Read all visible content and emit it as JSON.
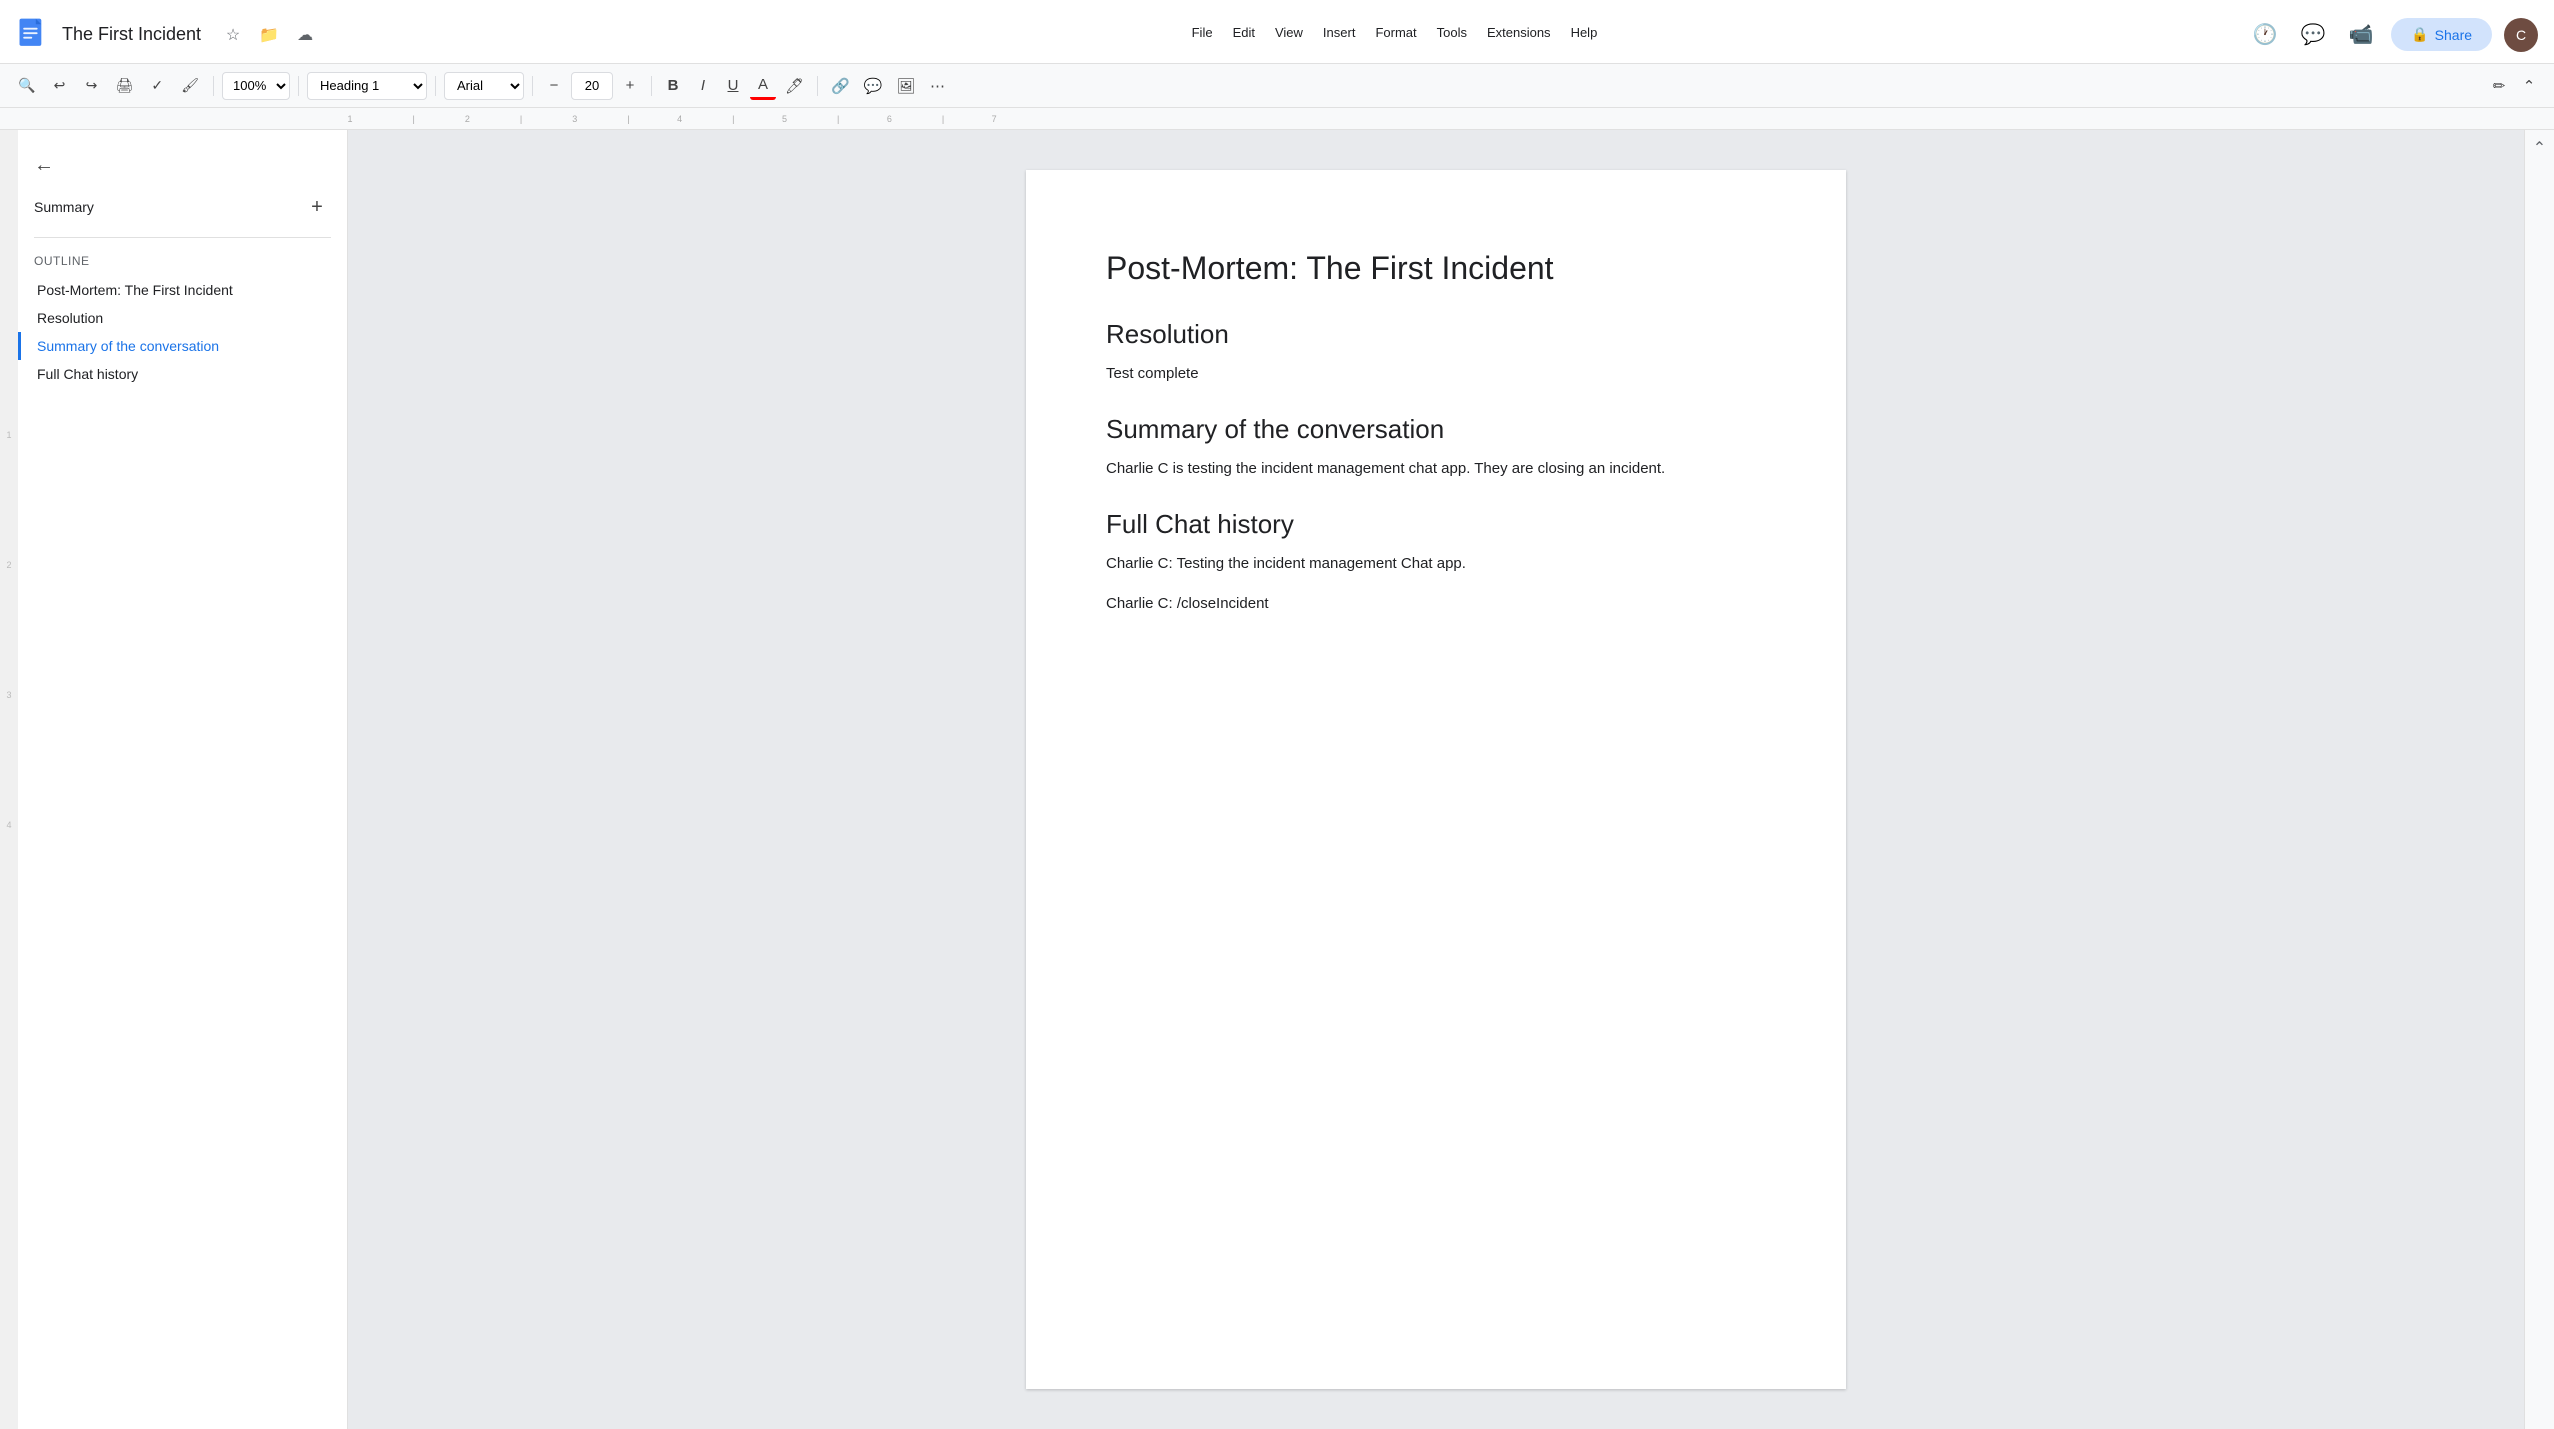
{
  "app": {
    "doc_icon_label": "G",
    "doc_title": "The First Incident",
    "menu_items": [
      "File",
      "Edit",
      "View",
      "Insert",
      "Format",
      "Tools",
      "Extensions",
      "Help"
    ],
    "share_label": "Share",
    "zoom": "100%",
    "style": "Heading 1",
    "font": "Arial",
    "font_size": "20",
    "toolbar": {
      "bold": "B",
      "italic": "I",
      "underline": "U",
      "minus": "−",
      "plus": "+"
    }
  },
  "sidebar": {
    "summary_label": "Summary",
    "outline_label": "Outline",
    "outline_items": [
      {
        "text": "Post-Mortem: The First Incident",
        "active": false
      },
      {
        "text": "Resolution",
        "active": false
      },
      {
        "text": "Summary of the conversation",
        "active": true
      },
      {
        "text": "Full Chat history",
        "active": false
      }
    ]
  },
  "document": {
    "title": "Post-Mortem: The First Incident",
    "sections": [
      {
        "heading": "Resolution",
        "body": "Test complete"
      },
      {
        "heading": "Summary of the conversation",
        "body": "Charlie C is testing the incident management chat app. They are closing an incident."
      },
      {
        "heading": "Full Chat history",
        "body_lines": [
          "Charlie C: Testing the incident management Chat app.",
          "Charlie C: /closeIncident"
        ]
      }
    ]
  }
}
